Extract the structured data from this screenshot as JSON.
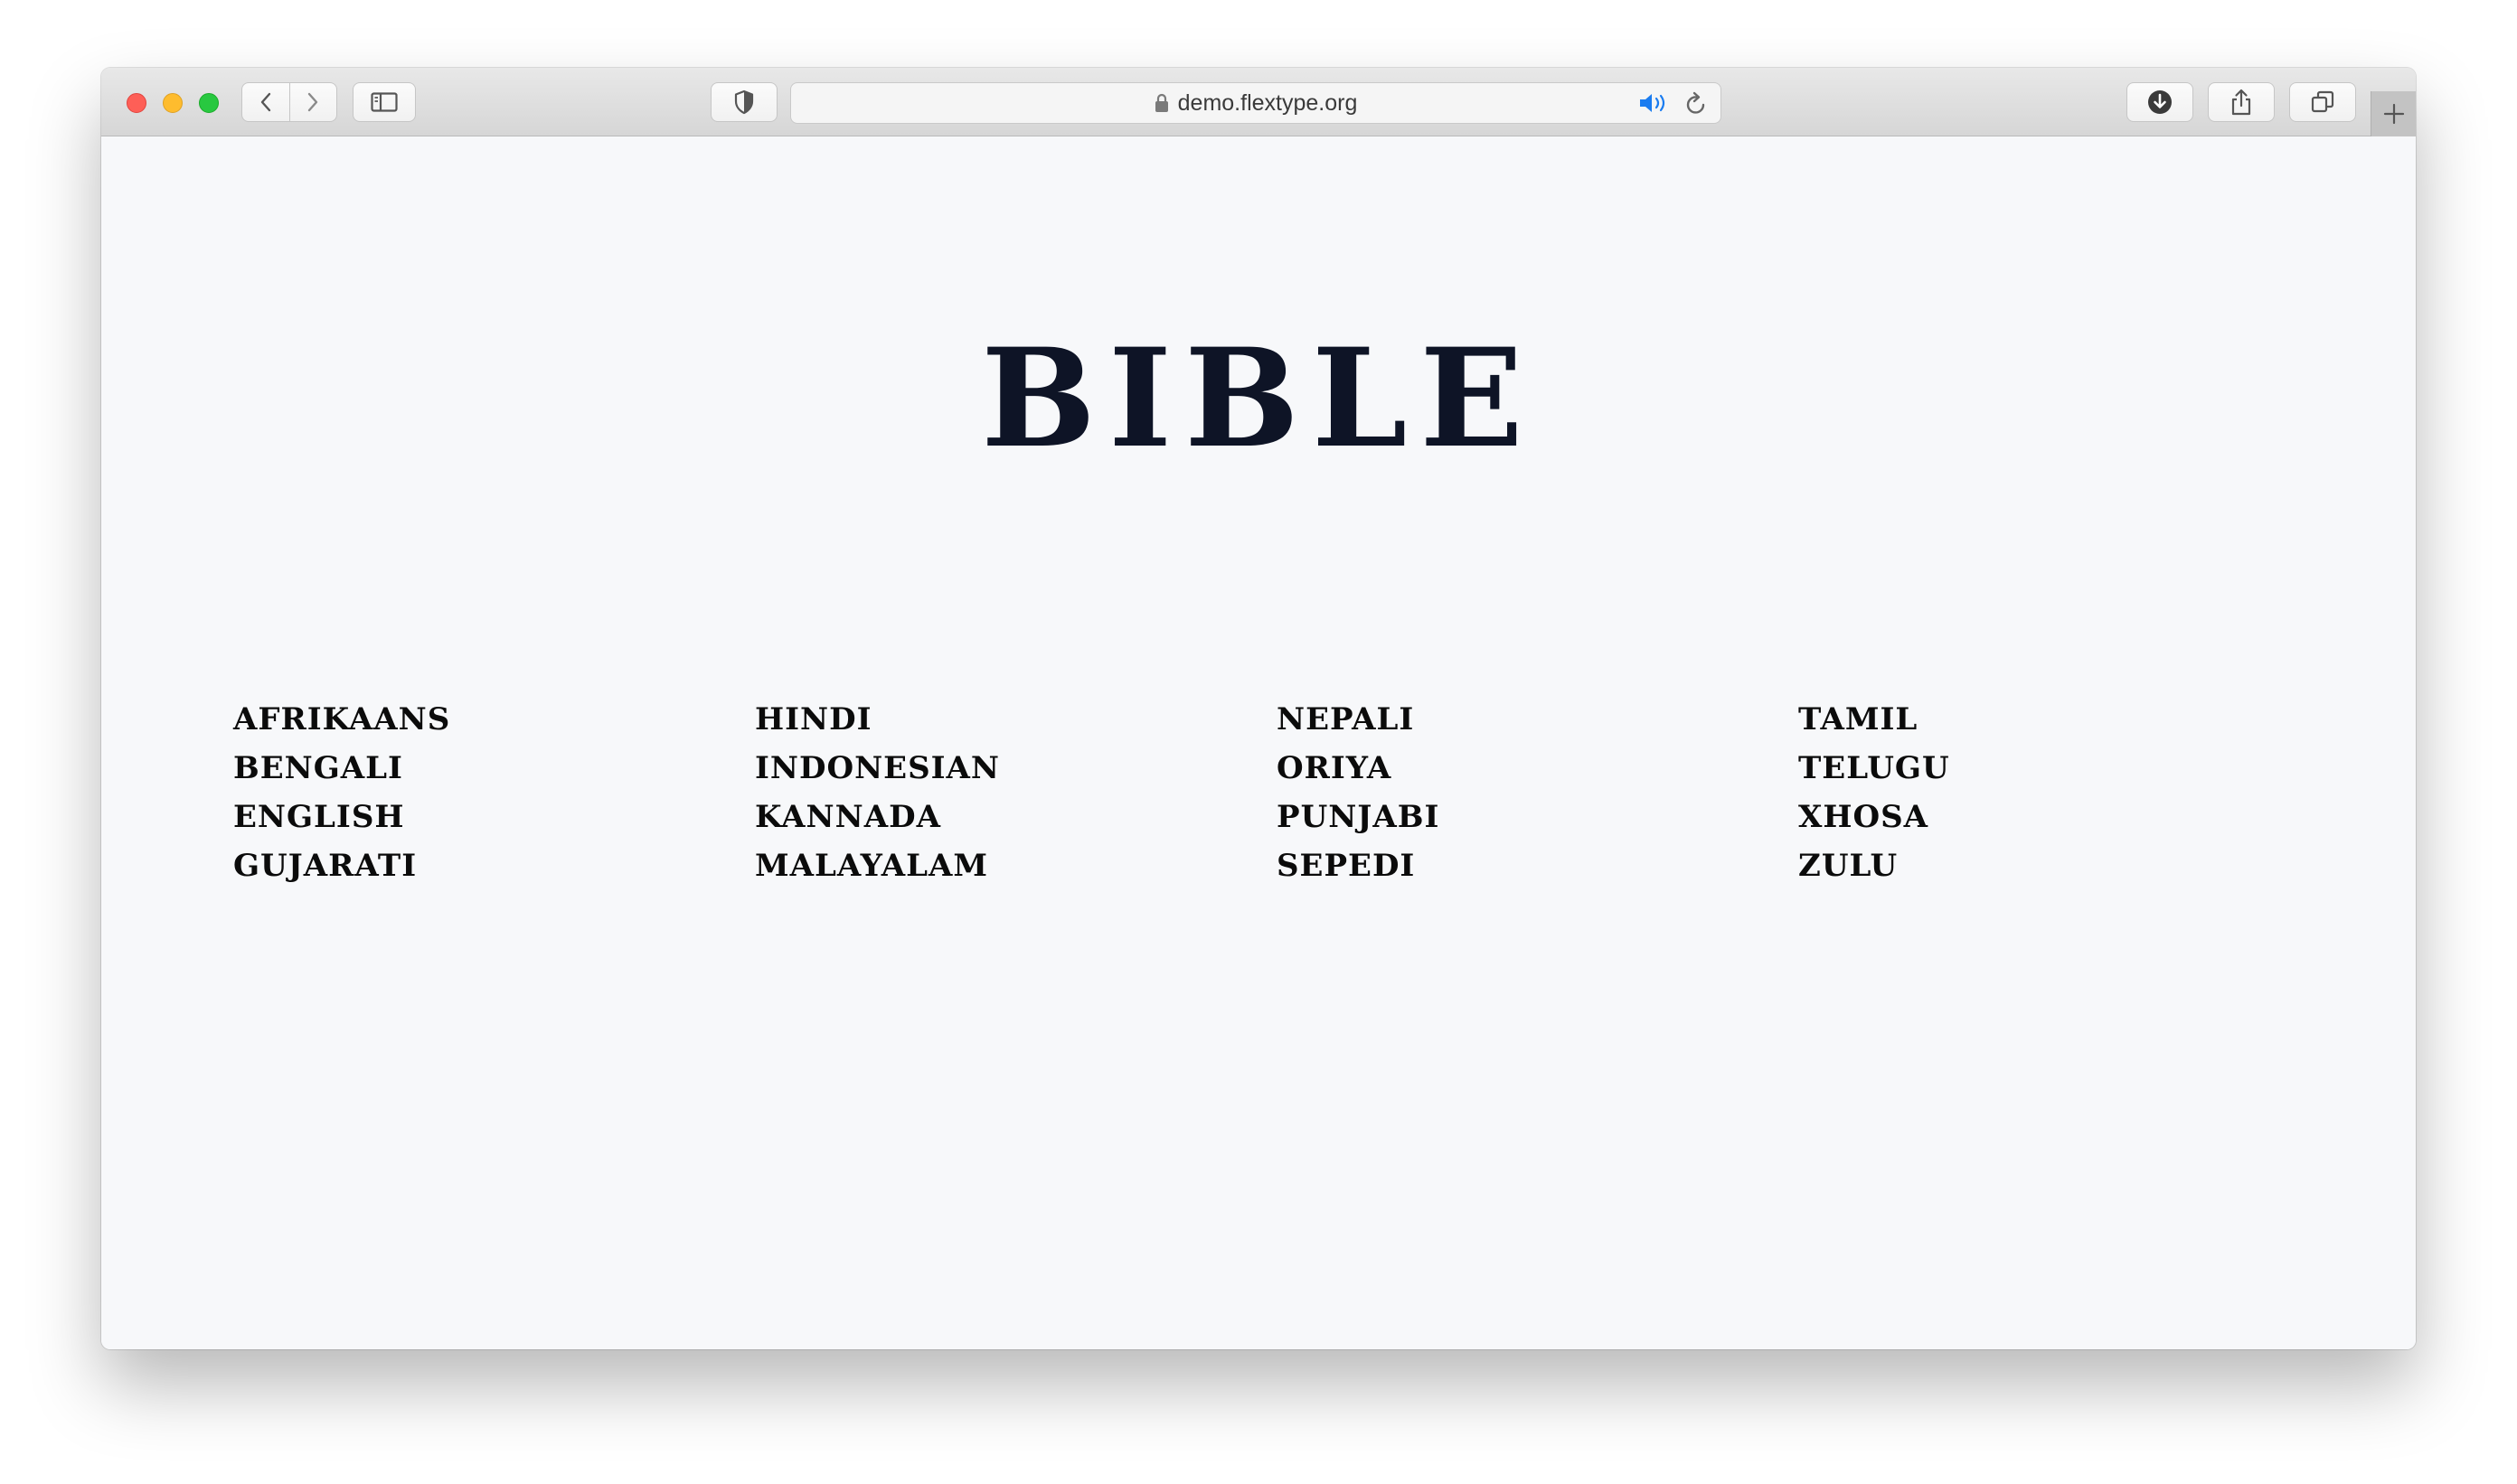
{
  "browser": {
    "url": "demo.flextype.org",
    "icons": {
      "back": "chevron-left-icon",
      "forward": "chevron-right-icon",
      "sidebar": "sidebar-icon",
      "privacy": "shield-icon",
      "lock": "lock-icon",
      "audio": "speaker-icon",
      "reload": "reload-icon",
      "downloads": "download-icon",
      "share": "share-icon",
      "tabs": "tab-overview-icon",
      "new_tab": "plus-icon"
    }
  },
  "page": {
    "title": "BIBLE",
    "columns": [
      [
        "AFRIKAANS",
        "BENGALI",
        "ENGLISH",
        "GUJARATI"
      ],
      [
        "HINDI",
        "INDONESIAN",
        "KANNADA",
        "MALAYALAM"
      ],
      [
        "NEPALI",
        "ORIYA",
        "PUNJABI",
        "SEPEDI"
      ],
      [
        "TAMIL",
        "TELUGU",
        "XHOSA",
        "ZULU"
      ]
    ]
  },
  "colors": {
    "title": "#0e1426",
    "text": "#0b0b0b",
    "background": "#f7f8fa",
    "accent_audio": "#1a7cf0"
  }
}
